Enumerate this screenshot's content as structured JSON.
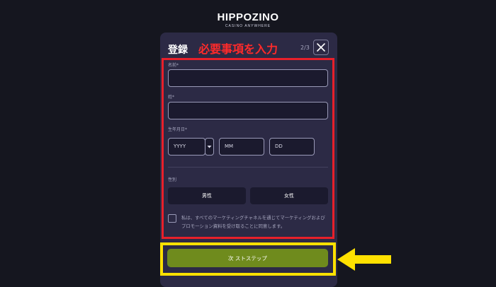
{
  "brand": {
    "name": "HIPPOZINO",
    "tagline": "CASINO ANYWHERE"
  },
  "modal": {
    "title": "登録",
    "annotation": "必要事項を入力",
    "step": "2/3",
    "close_icon": "close-icon"
  },
  "form": {
    "name_label": "名前*",
    "surname_label": "姓*",
    "dob_label": "生年月日*",
    "year_placeholder": "YYYY",
    "month_placeholder": "MM",
    "day_placeholder": "DD",
    "gender_label": "性別",
    "gender_male": "男性",
    "gender_female": "女性",
    "consent_text": "私は、すべてのマーケティングチャネルを通じてマーケティングおよびプロモーション資料を受け取ることに同意します。"
  },
  "footer": {
    "next_button": "次 ストステップ"
  },
  "colors": {
    "background": "#15161f",
    "modal": "#2c2a45",
    "highlight_red": "#e8202a",
    "highlight_yellow": "#ffe100",
    "button_green": "#6f8b1d"
  }
}
